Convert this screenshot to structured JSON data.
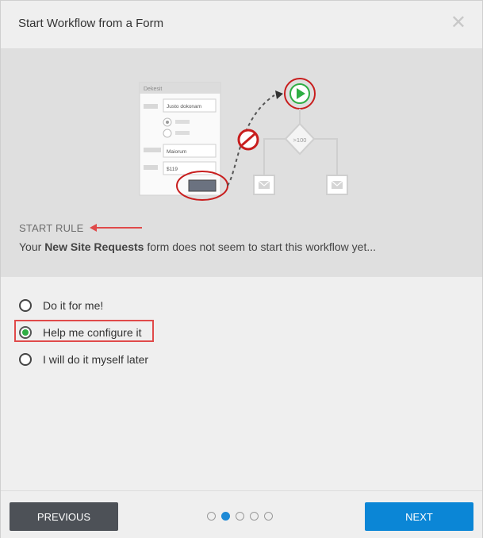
{
  "dialog": {
    "title": "Start Workflow from a Form",
    "close_icon": "close-icon"
  },
  "illustration": {
    "form_title": "Dekesit",
    "field1": "Justo dokonam",
    "field2": "Maiorum",
    "field3": "$119",
    "condition": ">100"
  },
  "rule": {
    "heading": "START RULE",
    "desc_prefix": "Your ",
    "form_name": "New Site Requests",
    "desc_suffix": " form does not seem to start this workflow yet..."
  },
  "options": [
    {
      "label": "Do it for me!",
      "selected": false
    },
    {
      "label": "Help me configure it",
      "selected": true
    },
    {
      "label": "I will do it myself later",
      "selected": false
    }
  ],
  "footer": {
    "previous_label": "PREVIOUS",
    "next_label": "NEXT",
    "pages": 5,
    "current_page": 2
  },
  "colors": {
    "next_button": "#0b86d6",
    "previous_button": "#4d5157",
    "highlight": "#e04a4a",
    "radio_selected": "#2fae44"
  }
}
